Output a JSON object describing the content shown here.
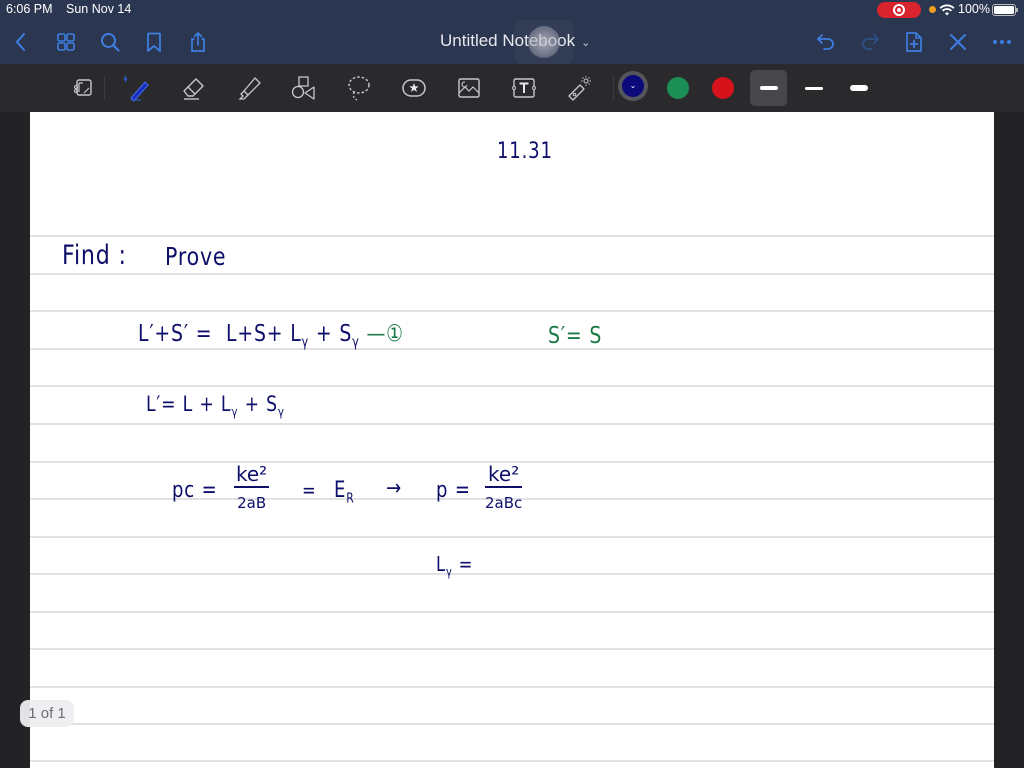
{
  "status_bar": {
    "time": "6:06 PM",
    "date": "Sun Nov 14",
    "battery_percent": "100%",
    "recording_icon": "screen-record-icon",
    "wifi_icon": "wifi-icon",
    "battery_icon": "battery-icon"
  },
  "nav_bar": {
    "title": "Untitled Notebook",
    "title_chevron": "⌄",
    "left_icons": [
      "back-icon",
      "thumbnails-icon",
      "search-icon",
      "bookmark-icon",
      "share-icon"
    ],
    "right_icons": [
      "undo-icon",
      "redo-icon",
      "add-page-icon",
      "close-icon",
      "more-icon"
    ],
    "accent_color": "#3d7ee0"
  },
  "toolbar": {
    "tools": [
      "read-mode",
      "pen",
      "eraser",
      "highlighter",
      "shapes",
      "lasso",
      "elements",
      "image",
      "text",
      "laser-pointer"
    ],
    "active_tool": "pen",
    "colors": [
      {
        "name": "navy",
        "hex": "#0a0a7a",
        "selected": true
      },
      {
        "name": "green",
        "hex": "#1b8f55",
        "selected": false
      },
      {
        "name": "red",
        "hex": "#d6121b",
        "selected": false
      }
    ],
    "thickness_options": [
      "medium",
      "thin",
      "thick"
    ],
    "selected_thickness": "medium",
    "color_chevron": "⌄"
  },
  "notebook": {
    "page_heading": "11.31",
    "lines": {
      "find_label": "Find :",
      "prove_label": "Prove",
      "eq1_lhs": "L′+S′",
      "eq1_eq": "=",
      "eq1_rhs": "L+S+ L",
      "eq1_sub_gamma": "γ",
      "eq1_plus": "+ S",
      "eq1_sub_gamma2": "γ",
      "eq1_marker": "—①",
      "side_note": "S′= S",
      "eq2": "L′= L + L",
      "eq2_sub": "γ",
      "eq2_tail": "+ S",
      "eq2_sub2": "γ",
      "eq3_lhs": "pc =",
      "eq3_frac1_num": "ke²",
      "eq3_frac1_den": "2aB",
      "eq3_eq2": "=",
      "eq3_er": "E",
      "eq3_er_sub": "R",
      "eq3_arrow": "→",
      "eq3_p": "p =",
      "eq3_frac2_num": "ke²",
      "eq3_frac2_den": "2aBc",
      "eq4": "L",
      "eq4_sub": "γ",
      "eq4_eq": "="
    },
    "ink_colors": {
      "navy": "#0d0f6a",
      "green": "#1b7a45"
    }
  },
  "page_indicator": "1 of 1"
}
